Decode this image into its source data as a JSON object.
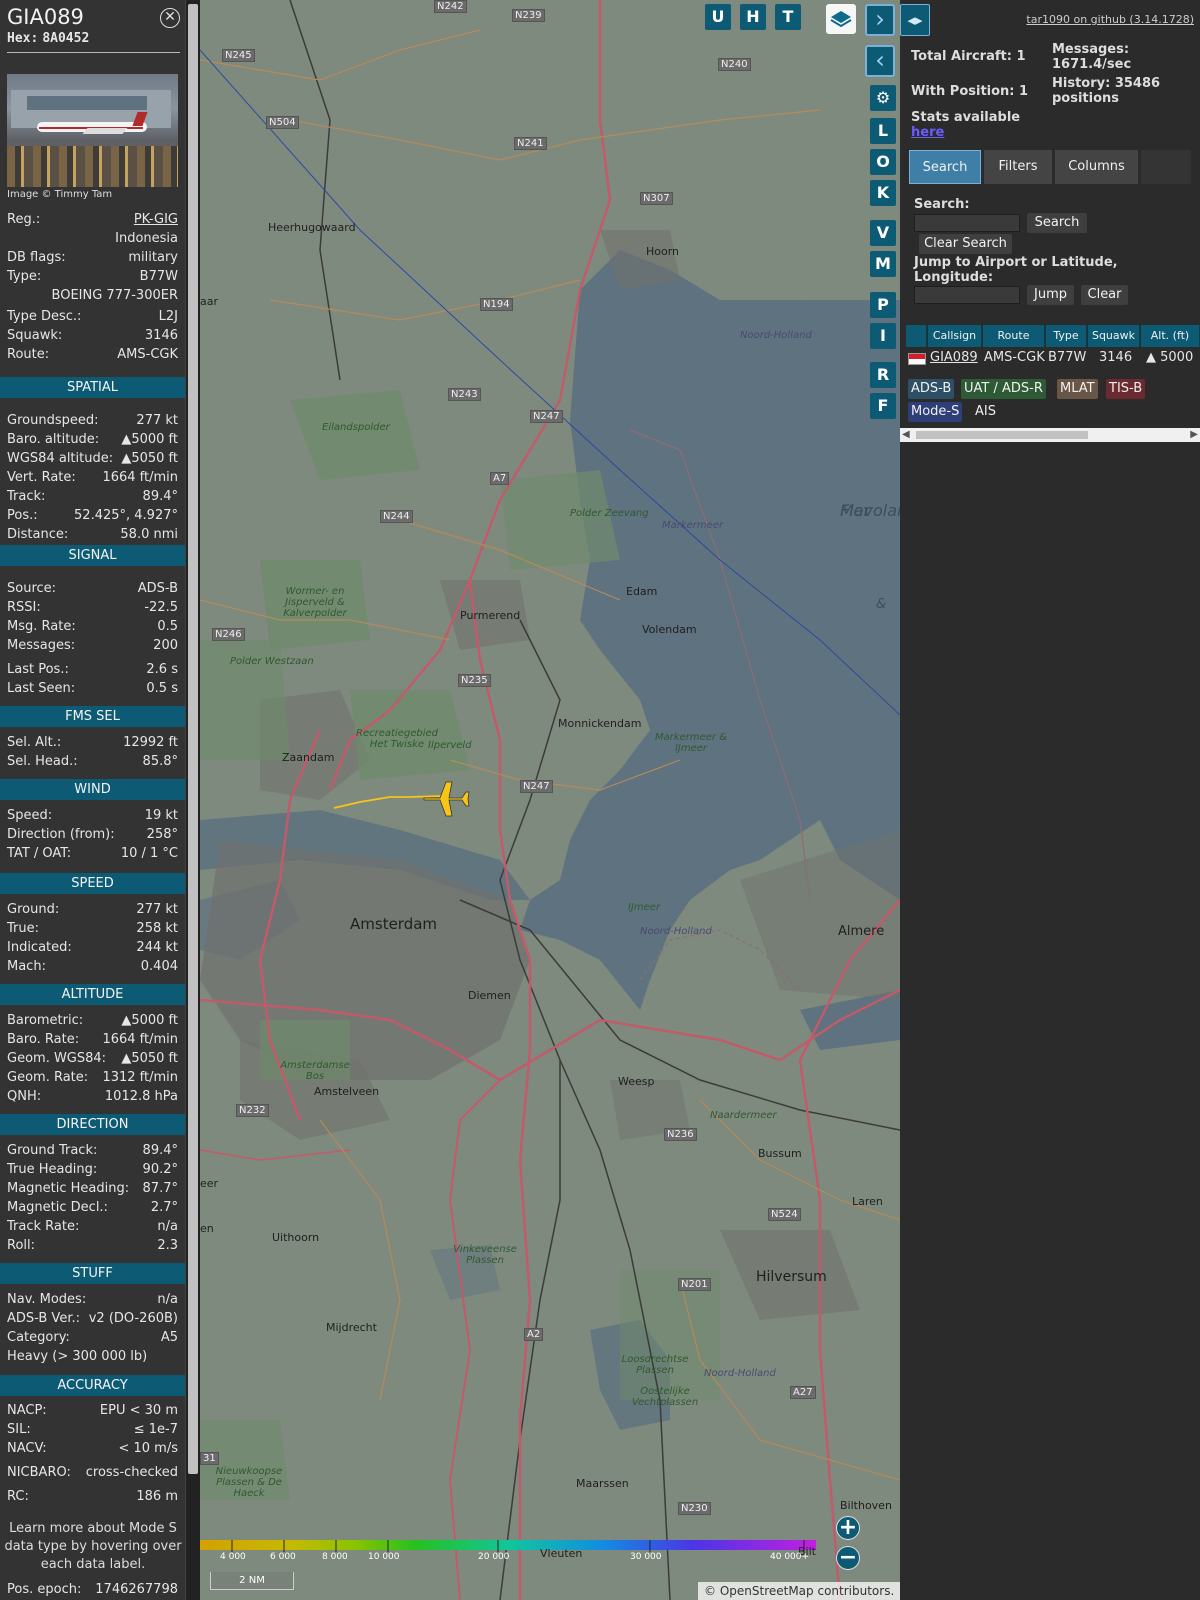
{
  "aircraft": {
    "callsign": "GIA089",
    "hex_label": "Hex:",
    "hex": "8A0452",
    "close_icon": "close-icon",
    "image_credit": "Image © Timmy Tam",
    "rows": [
      {
        "k": "Reg.:",
        "v": "PK-GIG"
      },
      {
        "k": "",
        "v": "Indonesia"
      },
      {
        "k": "DB flags:",
        "v": "military"
      },
      {
        "k": "Type:",
        "v": "B77W"
      },
      {
        "k": "",
        "v": "BOEING 777-300ER"
      },
      {
        "k": "Type Desc.:",
        "v": "L2J"
      },
      {
        "k": "Squawk:",
        "v": "3146"
      },
      {
        "k": "Route:",
        "v": "AMS-CGK"
      }
    ]
  },
  "sections": [
    {
      "title": "SPATIAL",
      "rows": [
        {
          "k": "Groundspeed:",
          "v": "277 kt"
        },
        {
          "k": "Baro. altitude:",
          "v": "▲5000 ft"
        },
        {
          "k": "WGS84 altitude:",
          "v": "▲5050 ft"
        },
        {
          "k": "Vert. Rate:",
          "v": "1664 ft/min"
        },
        {
          "k": "Track:",
          "v": "89.4°"
        },
        {
          "k": "Pos.:",
          "v": "52.425°, 4.927°"
        },
        {
          "k": "Distance:",
          "v": "58.0 nmi"
        }
      ]
    },
    {
      "title": "SIGNAL",
      "rows": [
        {
          "k": "Source:",
          "v": "ADS-B"
        },
        {
          "k": "RSSI:",
          "v": "-22.5"
        },
        {
          "k": "Msg. Rate:",
          "v": "0.5"
        },
        {
          "k": "Messages:",
          "v": "200"
        },
        {
          "k": "Last Pos.:",
          "v": "2.6 s"
        },
        {
          "k": "Last Seen:",
          "v": "0.5 s"
        }
      ]
    },
    {
      "title": "FMS SEL",
      "rows": [
        {
          "k": "Sel. Alt.:",
          "v": "12992 ft"
        },
        {
          "k": "Sel. Head.:",
          "v": "85.8°"
        }
      ]
    },
    {
      "title": "WIND",
      "rows": [
        {
          "k": "Speed:",
          "v": "19 kt"
        },
        {
          "k": "Direction (from):",
          "v": "258°"
        },
        {
          "k": "TAT / OAT:",
          "v": "10 / 1 °C"
        }
      ]
    },
    {
      "title": "SPEED",
      "rows": [
        {
          "k": "Ground:",
          "v": "277 kt"
        },
        {
          "k": "True:",
          "v": "258 kt"
        },
        {
          "k": "Indicated:",
          "v": "244 kt"
        },
        {
          "k": "Mach:",
          "v": "0.404"
        }
      ]
    },
    {
      "title": "ALTITUDE",
      "rows": [
        {
          "k": "Barometric:",
          "v": "▲5000 ft"
        },
        {
          "k": "Baro. Rate:",
          "v": "1664 ft/min"
        },
        {
          "k": "Geom. WGS84:",
          "v": "▲5050 ft"
        },
        {
          "k": "Geom. Rate:",
          "v": "1312 ft/min"
        },
        {
          "k": "QNH:",
          "v": "1012.8 hPa"
        }
      ]
    },
    {
      "title": "DIRECTION",
      "rows": [
        {
          "k": "Ground Track:",
          "v": "89.4°"
        },
        {
          "k": "True Heading:",
          "v": "90.2°"
        },
        {
          "k": "Magnetic Heading:",
          "v": "87.7°"
        },
        {
          "k": "Magnetic Decl.:",
          "v": "2.7°"
        },
        {
          "k": "Track Rate:",
          "v": "n/a"
        },
        {
          "k": "Roll:",
          "v": "2.3"
        }
      ]
    },
    {
      "title": "STUFF",
      "rows": [
        {
          "k": "Nav. Modes:",
          "v": "n/a"
        },
        {
          "k": "ADS-B Ver.:",
          "v": "v2 (DO-260B)"
        },
        {
          "k": "Category:",
          "v": "A5"
        },
        {
          "k": "Heavy (> 300 000 lb)",
          "v": ""
        }
      ]
    },
    {
      "title": "ACCURACY",
      "rows": [
        {
          "k": "NACP:",
          "v": "EPU < 30 m"
        },
        {
          "k": "SIL:",
          "v": "≤ 1e-7"
        },
        {
          "k": "NACV:",
          "v": "< 10 m/s"
        },
        {
          "k": "NICBARO:",
          "v": "cross-checked"
        },
        {
          "k": "RC:",
          "v": "186 m"
        }
      ]
    }
  ],
  "learn_more": "Learn more about Mode S data type by hovering over each data label.",
  "pos_epoch": {
    "k": "Pos. epoch:",
    "v": "1746267798"
  },
  "map": {
    "buttons": [
      "U",
      "H",
      "T"
    ],
    "side_buttons": [
      "L",
      "O",
      "K",
      "V",
      "M",
      "P",
      "I",
      "R",
      "F"
    ],
    "scale_ticks": [
      "4 000",
      "6 000",
      "8 000",
      "10 000",
      "20 000",
      "30 000",
      "40 000+"
    ],
    "scale_unit": "2 NM",
    "attribution": "© OpenStreetMap contributors.",
    "labels": [
      "N242",
      "N239",
      "N245",
      "N240",
      "N504",
      "N241",
      "Heerhugowaard",
      "N307",
      "Hoorn",
      "N194",
      "Noord-Holland",
      "N243",
      "N247",
      "Eilandspolder",
      "A7",
      "N244",
      "Polder Zeevang",
      "Markermeer",
      "Flevoland",
      "Wormer- en Jisperveld & Kalverpolder",
      "Edam",
      "Purmerend",
      "Volendam",
      "N246",
      "Polder Westzaan",
      "N235",
      "Monnickendam",
      "Recreatiegebied Het Twiske",
      "Ilperveld",
      "Markermeer & IJmeer",
      "Zaandam",
      "N247",
      "Amsterdam",
      "IJmeer",
      "Noord-Holland",
      "Almere",
      "Diemen",
      "Amsterdamse Bos",
      "Amstelveen",
      "Weesp",
      "N232",
      "Naardermeer",
      "N236",
      "Bussum",
      "N524",
      "Laren",
      "Uithoorn",
      "Vinkeveense Plassen",
      "N201",
      "Hilversum",
      "Mijdrecht",
      "A2",
      "Loosdrechtse Plassen",
      "Oostelijke Vechtplassen",
      "A27",
      "Noord-Holland",
      "Maarssen",
      "N230",
      "Bilthoven",
      "Nieuwkoopse Plassen & De Haeck",
      "Vleuten",
      "Bilt",
      "aar",
      "Mar",
      "&",
      "eer",
      "en",
      "31"
    ]
  },
  "side": {
    "version_link": "tar1090 on github (3.14.1728)",
    "total_aircraft": "Total Aircraft: 1",
    "messages": "Messages: 1671.4/sec",
    "with_position": "With Position: 1",
    "history": "History: 35486 positions",
    "stats_text": "Stats available",
    "stats_link": "here",
    "tabs": [
      "Search",
      "Filters",
      "Columns"
    ],
    "search_label": "Search:",
    "search_button": "Search",
    "clear_search_button": "Clear Search",
    "jump_label": "Jump to Airport or Latitude, Longitude:",
    "jump_button": "Jump",
    "clear_button": "Clear",
    "columns": [
      "Callsign",
      "Route",
      "Type",
      "Squawk",
      "Alt. (ft)"
    ],
    "rows": [
      {
        "callsign": "GIA089",
        "route": "AMS-CGK",
        "type": "B77W",
        "squawk": "3146",
        "alt": "▲ 5000"
      }
    ],
    "sources": [
      "ADS-B",
      "UAT / ADS-R",
      "MLAT",
      "TIS-B",
      "Mode-S",
      "AIS"
    ]
  },
  "colors": {
    "accent": "#0d5a75",
    "aircraft": "#f5c518",
    "track": "#f5c518"
  }
}
